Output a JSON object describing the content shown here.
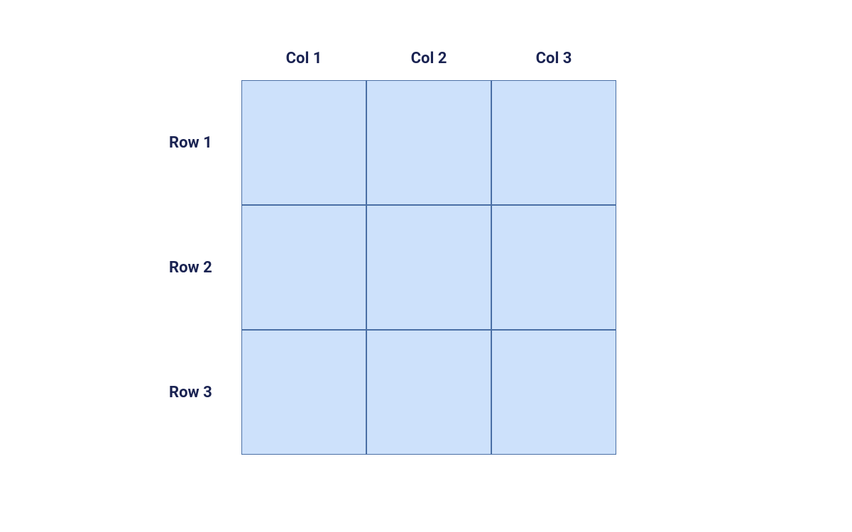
{
  "grid": {
    "columns": [
      "Col 1",
      "Col 2",
      "Col 3"
    ],
    "rows": [
      "Row 1",
      "Row 2",
      "Row 3"
    ],
    "cells": [
      [
        "",
        "",
        ""
      ],
      [
        "",
        "",
        ""
      ],
      [
        "",
        "",
        ""
      ]
    ],
    "colors": {
      "cell_fill": "#cde1fb",
      "cell_border": "#4a6fa5",
      "label_text": "#1a2352"
    }
  }
}
